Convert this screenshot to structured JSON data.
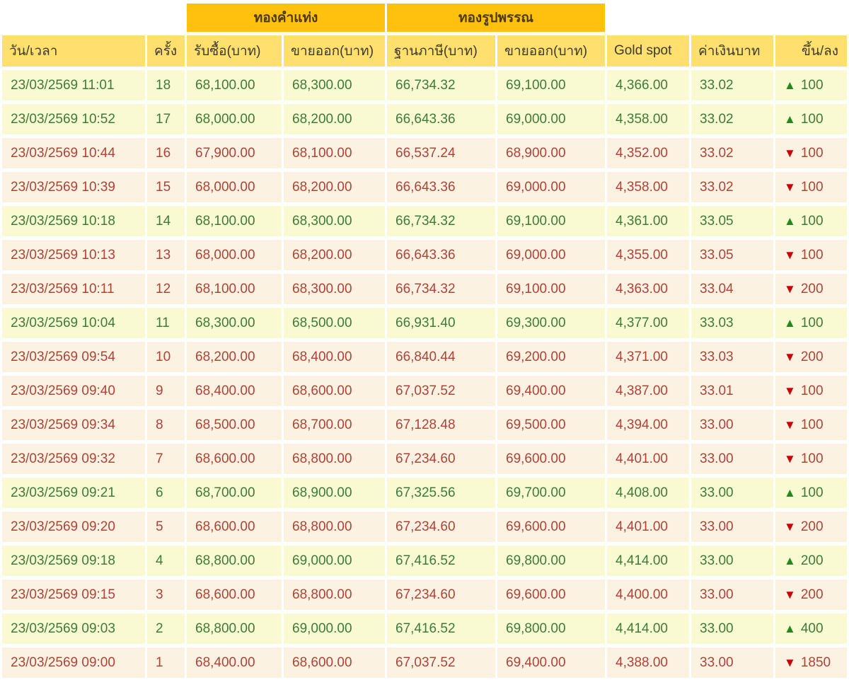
{
  "colors": {
    "band_bg": "#FFC10D",
    "header_bg": "#FFE06E",
    "row_up_bg": "#FAFAD2",
    "row_down_bg": "#FBF2E1",
    "up_text": "#3E7B3A",
    "down_text": "#B0423A",
    "up_arrow": "#1F8A1F",
    "down_arrow": "#C40505"
  },
  "icons": {
    "up_arrow": "▲",
    "down_arrow": "▼"
  },
  "table": {
    "group_headers": {
      "gold_bar": "ทองคำแท่ง",
      "gold_ornament": "ทองรูปพรรณ"
    },
    "columns": [
      "วัน/เวลา",
      "ครั้ง",
      "รับซื้อ(บาท)",
      "ขายออก(บาท)",
      "ฐานภาษี(บาท)",
      "ขายออก(บาท)",
      "Gold spot",
      "ค่าเงินบาท",
      "ขึ้น/ลง"
    ],
    "rows": [
      {
        "time": "23/03/2569 11:01",
        "no": "18",
        "buy": "68,100.00",
        "sell": "68,300.00",
        "tax_base": "66,734.32",
        "sell_ornament": "69,100.00",
        "gold_spot": "4,366.00",
        "baht": "33.02",
        "direction": "up",
        "change": "100"
      },
      {
        "time": "23/03/2569 10:52",
        "no": "17",
        "buy": "68,000.00",
        "sell": "68,200.00",
        "tax_base": "66,643.36",
        "sell_ornament": "69,000.00",
        "gold_spot": "4,358.00",
        "baht": "33.02",
        "direction": "up",
        "change": "100"
      },
      {
        "time": "23/03/2569 10:44",
        "no": "16",
        "buy": "67,900.00",
        "sell": "68,100.00",
        "tax_base": "66,537.24",
        "sell_ornament": "68,900.00",
        "gold_spot": "4,352.00",
        "baht": "33.02",
        "direction": "down",
        "change": "100"
      },
      {
        "time": "23/03/2569 10:39",
        "no": "15",
        "buy": "68,000.00",
        "sell": "68,200.00",
        "tax_base": "66,643.36",
        "sell_ornament": "69,000.00",
        "gold_spot": "4,358.00",
        "baht": "33.02",
        "direction": "down",
        "change": "100"
      },
      {
        "time": "23/03/2569 10:18",
        "no": "14",
        "buy": "68,100.00",
        "sell": "68,300.00",
        "tax_base": "66,734.32",
        "sell_ornament": "69,100.00",
        "gold_spot": "4,361.00",
        "baht": "33.05",
        "direction": "up",
        "change": "100"
      },
      {
        "time": "23/03/2569 10:13",
        "no": "13",
        "buy": "68,000.00",
        "sell": "68,200.00",
        "tax_base": "66,643.36",
        "sell_ornament": "69,000.00",
        "gold_spot": "4,355.00",
        "baht": "33.05",
        "direction": "down",
        "change": "100"
      },
      {
        "time": "23/03/2569 10:11",
        "no": "12",
        "buy": "68,100.00",
        "sell": "68,300.00",
        "tax_base": "66,734.32",
        "sell_ornament": "69,100.00",
        "gold_spot": "4,363.00",
        "baht": "33.04",
        "direction": "down",
        "change": "200"
      },
      {
        "time": "23/03/2569 10:04",
        "no": "11",
        "buy": "68,300.00",
        "sell": "68,500.00",
        "tax_base": "66,931.40",
        "sell_ornament": "69,300.00",
        "gold_spot": "4,377.00",
        "baht": "33.03",
        "direction": "up",
        "change": "100"
      },
      {
        "time": "23/03/2569 09:54",
        "no": "10",
        "buy": "68,200.00",
        "sell": "68,400.00",
        "tax_base": "66,840.44",
        "sell_ornament": "69,200.00",
        "gold_spot": "4,371.00",
        "baht": "33.03",
        "direction": "down",
        "change": "200"
      },
      {
        "time": "23/03/2569 09:40",
        "no": "9",
        "buy": "68,400.00",
        "sell": "68,600.00",
        "tax_base": "67,037.52",
        "sell_ornament": "69,400.00",
        "gold_spot": "4,387.00",
        "baht": "33.01",
        "direction": "down",
        "change": "100"
      },
      {
        "time": "23/03/2569 09:34",
        "no": "8",
        "buy": "68,500.00",
        "sell": "68,700.00",
        "tax_base": "67,128.48",
        "sell_ornament": "69,500.00",
        "gold_spot": "4,394.00",
        "baht": "33.00",
        "direction": "down",
        "change": "100"
      },
      {
        "time": "23/03/2569 09:32",
        "no": "7",
        "buy": "68,600.00",
        "sell": "68,800.00",
        "tax_base": "67,234.60",
        "sell_ornament": "69,600.00",
        "gold_spot": "4,401.00",
        "baht": "33.00",
        "direction": "down",
        "change": "100"
      },
      {
        "time": "23/03/2569 09:21",
        "no": "6",
        "buy": "68,700.00",
        "sell": "68,900.00",
        "tax_base": "67,325.56",
        "sell_ornament": "69,700.00",
        "gold_spot": "4,408.00",
        "baht": "33.00",
        "direction": "up",
        "change": "100"
      },
      {
        "time": "23/03/2569 09:20",
        "no": "5",
        "buy": "68,600.00",
        "sell": "68,800.00",
        "tax_base": "67,234.60",
        "sell_ornament": "69,600.00",
        "gold_spot": "4,401.00",
        "baht": "33.00",
        "direction": "down",
        "change": "200"
      },
      {
        "time": "23/03/2569 09:18",
        "no": "4",
        "buy": "68,800.00",
        "sell": "69,000.00",
        "tax_base": "67,416.52",
        "sell_ornament": "69,800.00",
        "gold_spot": "4,414.00",
        "baht": "33.00",
        "direction": "up",
        "change": "200"
      },
      {
        "time": "23/03/2569 09:15",
        "no": "3",
        "buy": "68,600.00",
        "sell": "68,800.00",
        "tax_base": "67,234.60",
        "sell_ornament": "69,600.00",
        "gold_spot": "4,400.00",
        "baht": "33.00",
        "direction": "down",
        "change": "200"
      },
      {
        "time": "23/03/2569 09:03",
        "no": "2",
        "buy": "68,800.00",
        "sell": "69,000.00",
        "tax_base": "67,416.52",
        "sell_ornament": "69,800.00",
        "gold_spot": "4,414.00",
        "baht": "33.00",
        "direction": "up",
        "change": "400"
      },
      {
        "time": "23/03/2569 09:00",
        "no": "1",
        "buy": "68,400.00",
        "sell": "68,600.00",
        "tax_base": "67,037.52",
        "sell_ornament": "69,400.00",
        "gold_spot": "4,388.00",
        "baht": "33.00",
        "direction": "down",
        "change": "1850"
      }
    ]
  }
}
